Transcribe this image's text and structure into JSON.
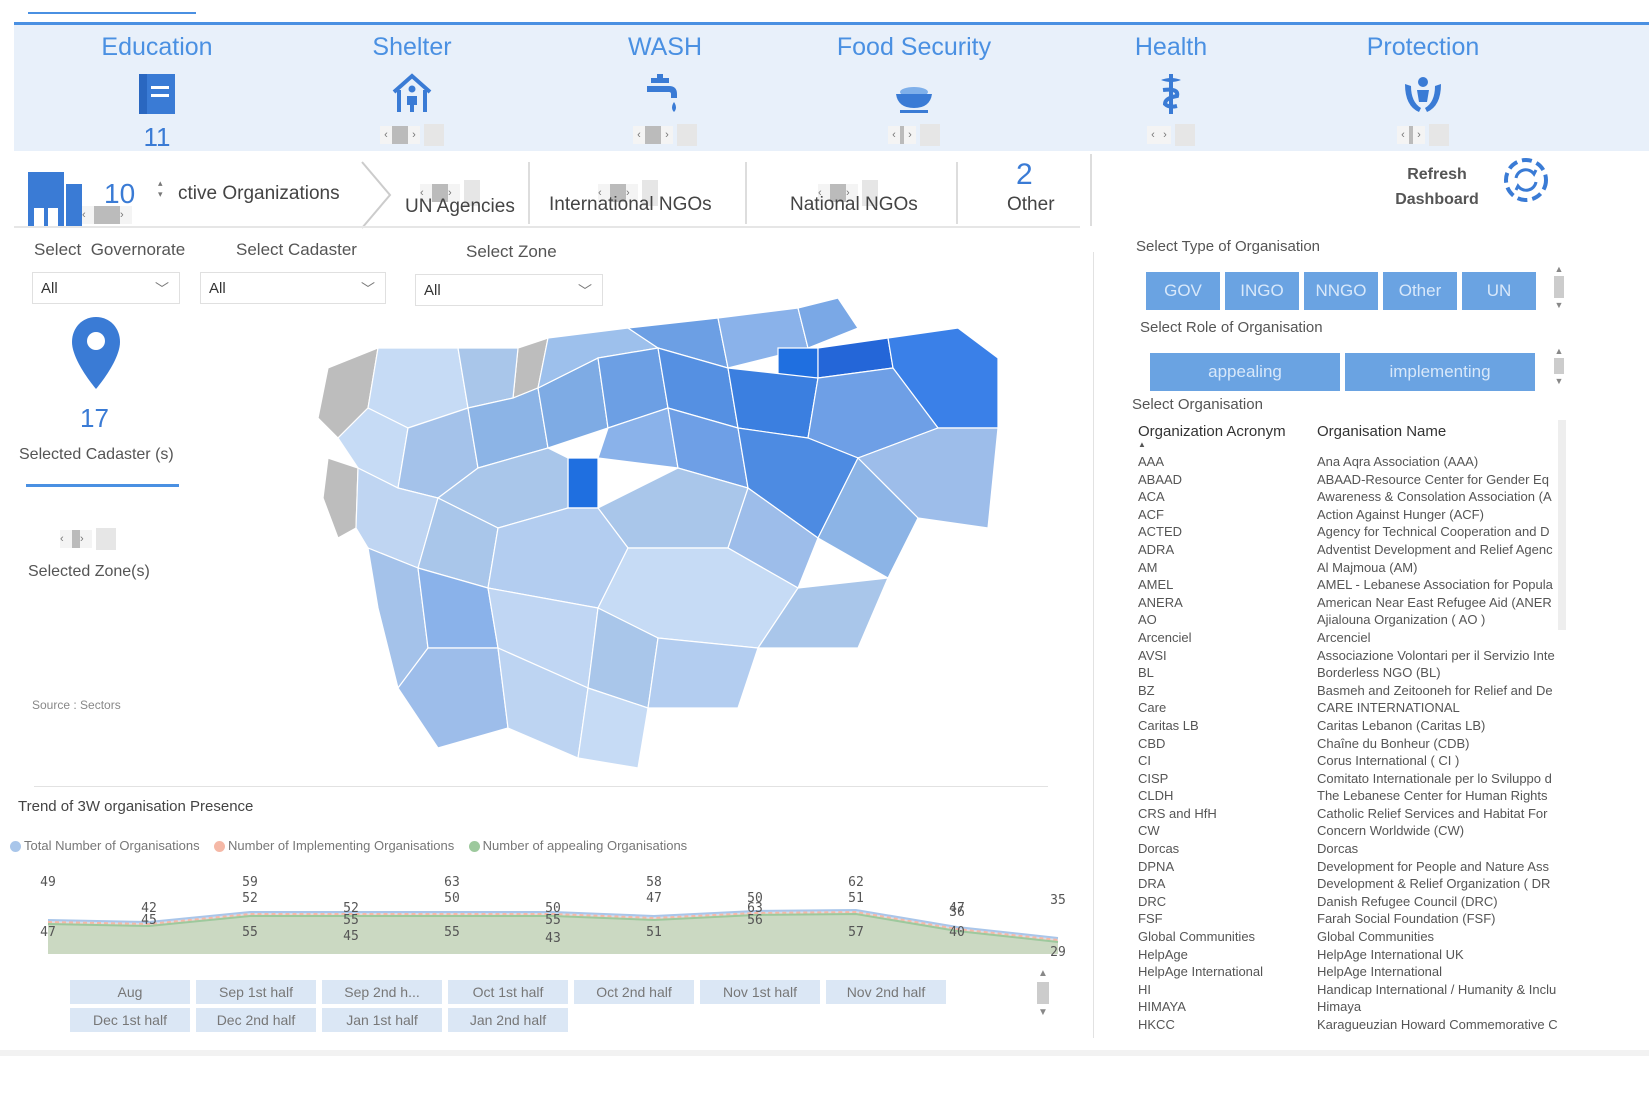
{
  "sectors": [
    {
      "label": "Education",
      "icon": "book-icon",
      "count": "11"
    },
    {
      "label": "Shelter",
      "icon": "shelter-icon",
      "count": ""
    },
    {
      "label": "WASH",
      "icon": "tap-icon",
      "count": ""
    },
    {
      "label": "Food Security",
      "icon": "food-bowl-icon",
      "count": ""
    },
    {
      "label": "Health",
      "icon": "health-icon",
      "count": ""
    },
    {
      "label": "Protection",
      "icon": "protection-hands-icon",
      "count": ""
    }
  ],
  "org_strip": {
    "active_label": "ctive Organizations",
    "active_partial": "10",
    "un": "UN Agencies",
    "ingo": "International NGOs",
    "nngo": "National NGOs",
    "other_count": "2",
    "other": "Other",
    "refresh": "Refresh\nDashboard"
  },
  "filters": {
    "governorate_label": "Select  Governorate",
    "cadaster_label": "Select Cadaster",
    "zone_label": "Select Zone",
    "governorate_value": "All",
    "cadaster_value": "All",
    "zone_value": "All"
  },
  "left_panel": {
    "cadaster_count": "17",
    "cadaster_label": "Selected Cadaster (s)",
    "zone_label": "Selected Zone(s)",
    "source": "Source : Sectors"
  },
  "org_type": {
    "label": "Select Type of Organisation",
    "buttons": [
      "GOV",
      "INGO",
      "NNGO",
      "Other",
      "UN"
    ]
  },
  "org_role": {
    "label": "Select Role of Organisation",
    "buttons": [
      "appealing",
      "implementing"
    ]
  },
  "org_select_label": "Select Organisation",
  "table": {
    "col1": "Organization Acronym",
    "col2": "Organisation Name",
    "rows": [
      [
        "AAA",
        "Ana Aqra Association (AAA)"
      ],
      [
        "ABAAD",
        "ABAAD-Resource Center for Gender Eq"
      ],
      [
        "ACA",
        "Awareness & Consolation Association (A"
      ],
      [
        "ACF",
        "Action Against Hunger (ACF)"
      ],
      [
        "ACTED",
        "Agency for Technical Cooperation and D"
      ],
      [
        "ADRA",
        "Adventist Development and Relief Agenc"
      ],
      [
        "AM",
        "Al Majmoua (AM)"
      ],
      [
        "AMEL",
        "AMEL - Lebanese Association for Popula"
      ],
      [
        "ANERA",
        "American Near East Refugee Aid (ANER"
      ],
      [
        "AO",
        "Ajialouna Organization ( AO )"
      ],
      [
        "Arcenciel",
        "Arcenciel"
      ],
      [
        "AVSI",
        "Associazione Volontari per il Servizio Inte"
      ],
      [
        "BL",
        "Borderless NGO (BL)"
      ],
      [
        "BZ",
        "Basmeh and Zeitooneh for Relief and De"
      ],
      [
        "Care",
        "CARE INTERNATIONAL"
      ],
      [
        "Caritas LB",
        "Caritas Lebanon (Caritas LB)"
      ],
      [
        "CBD",
        "Chaîne du Bonheur (CDB)"
      ],
      [
        "CI",
        "Corus International ( CI )"
      ],
      [
        "CISP",
        "Comitato Internationale per lo Sviluppo d"
      ],
      [
        "CLDH",
        "The Lebanese Center for Human Rights"
      ],
      [
        "CRS and HfH",
        "Catholic Relief Services and Habitat For"
      ],
      [
        "CW",
        "Concern Worldwide (CW)"
      ],
      [
        "Dorcas",
        "Dorcas"
      ],
      [
        "DPNA",
        "Development for People and Nature Ass"
      ],
      [
        "DRA",
        "Development & Relief Organization ( DR"
      ],
      [
        "DRC",
        "Danish Refugee Council (DRC)"
      ],
      [
        "FSF",
        "Farah Social Foundation (FSF)"
      ],
      [
        "Global Communities",
        "Global Communities"
      ],
      [
        "HelpAge",
        "HelpAge International UK"
      ],
      [
        "HelpAge International",
        "HelpAge International"
      ],
      [
        "HI",
        "Handicap International / Humanity & Inclu"
      ],
      [
        "HIMAYA",
        "Himaya"
      ],
      [
        "HKCC",
        "Karagueuzian Howard Commemorative C"
      ]
    ]
  },
  "trend_title": "Trend of 3W organisation Presence",
  "chart_data": {
    "type": "area",
    "categories": [
      "Aug",
      "Sep 1st half",
      "Sep 2nd h...",
      "Oct 1st half",
      "Oct 2nd half",
      "Nov 1st half",
      "Nov 2nd half",
      "Dec 1st half",
      "Dec 2nd half",
      "Jan 1st half",
      "Jan 2nd half"
    ],
    "series": [
      {
        "name": "Total Number of Organisations",
        "color": "#a9c6ea",
        "values": [
          49,
          42,
          59,
          52,
          63,
          50,
          58,
          63,
          62,
          47,
          35
        ]
      },
      {
        "name": "Number of Implementing Organisations",
        "color": "#f5b8a6",
        "values": [
          null,
          null,
          52,
          null,
          50,
          null,
          47,
          50,
          51,
          36,
          null
        ]
      },
      {
        "name": "Number of appealing Organisations",
        "color": "#9dc99d",
        "values": [
          47,
          45,
          55,
          55,
          55,
          55,
          51,
          56,
          57,
          40,
          29
        ]
      }
    ],
    "extra_labels": [
      "45",
      "43"
    ],
    "legend_position": "top-left"
  }
}
